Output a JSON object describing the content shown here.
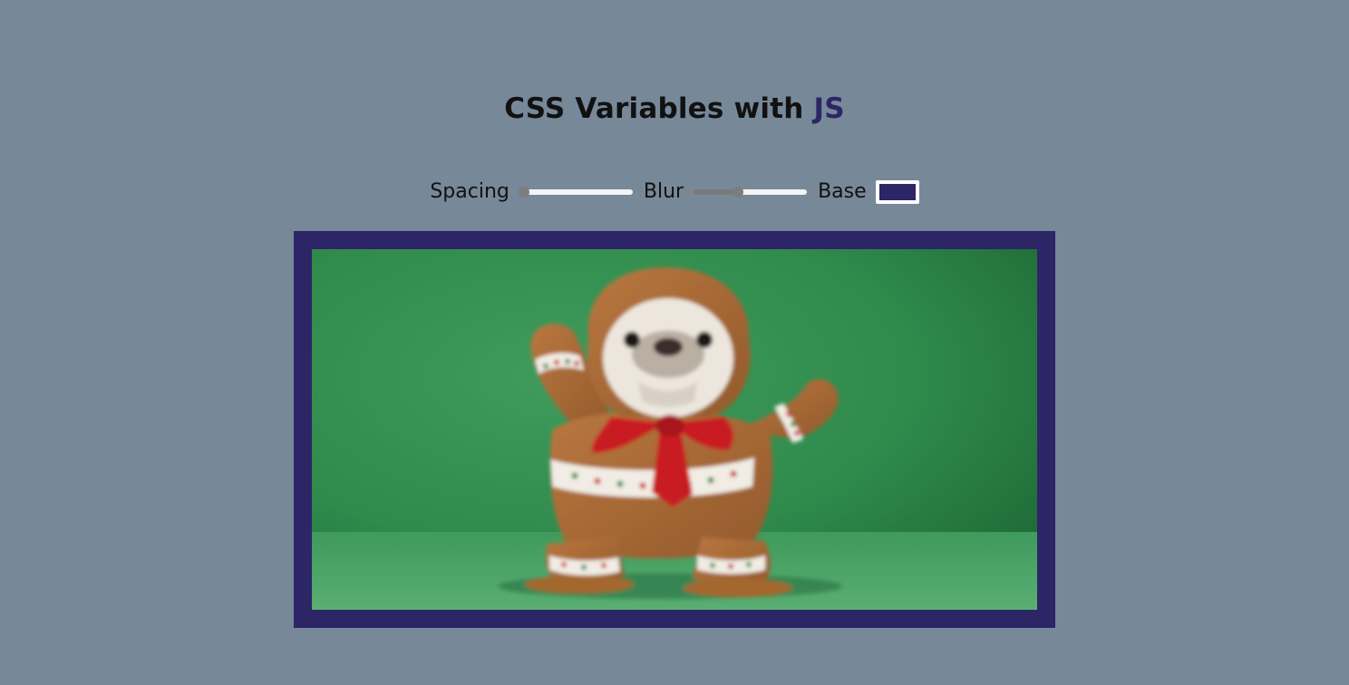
{
  "header": {
    "title_prefix": "CSS Variables with ",
    "title_highlight": "JS"
  },
  "controls": {
    "spacing": {
      "label": "Spacing",
      "value": 10,
      "min": 10,
      "max": 200
    },
    "blur": {
      "label": "Blur",
      "value": 10,
      "min": 0,
      "max": 25
    },
    "base": {
      "label": "Base",
      "value": "#2c2566"
    }
  },
  "colors": {
    "background": "#778899",
    "base": "#2c2566",
    "highlight": "#2c2566"
  },
  "image": {
    "subject": "dog-in-gingerbread-costume",
    "background_color": "#2f8a4c"
  }
}
